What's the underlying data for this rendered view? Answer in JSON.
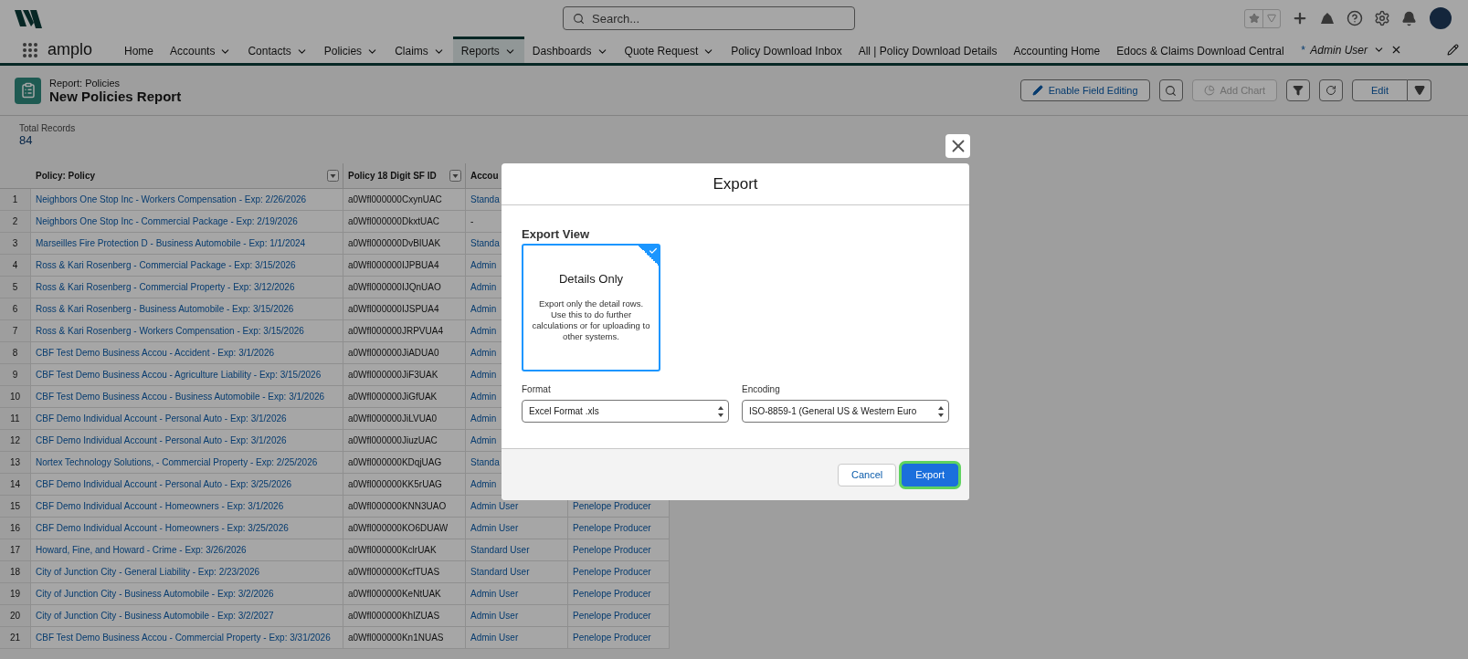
{
  "app": {
    "name": "amplo"
  },
  "search": {
    "placeholder": "Search..."
  },
  "nav": [
    {
      "label": "Home",
      "dropdown": false,
      "selected": false
    },
    {
      "label": "Accounts",
      "dropdown": true,
      "selected": false
    },
    {
      "label": "Contacts",
      "dropdown": true,
      "selected": false
    },
    {
      "label": "Policies",
      "dropdown": true,
      "selected": false
    },
    {
      "label": "Claims",
      "dropdown": true,
      "selected": false
    },
    {
      "label": "Reports",
      "dropdown": true,
      "selected": true
    },
    {
      "label": "Dashboards",
      "dropdown": true,
      "selected": false
    },
    {
      "label": "Quote Request",
      "dropdown": true,
      "selected": false
    },
    {
      "label": "Policy Download Inbox",
      "dropdown": false,
      "selected": false
    },
    {
      "label": "All | Policy Download Details",
      "dropdown": false,
      "selected": false
    },
    {
      "label": "Accounting Home",
      "dropdown": false,
      "selected": false
    },
    {
      "label": "Edocs & Claims Download Central",
      "dropdown": false,
      "selected": false
    }
  ],
  "record_tab": {
    "marker": "*",
    "label": "Admin User"
  },
  "report": {
    "type_label": "Report: Policies",
    "title": "New Policies Report"
  },
  "actions": [
    {
      "label": "Enable Field Editing",
      "disabled": false
    },
    {
      "label": "Add Chart",
      "disabled": true
    },
    {
      "label": "Edit",
      "disabled": false
    }
  ],
  "summary": {
    "label": "Total Records",
    "value": "84"
  },
  "table": {
    "columns": [
      {
        "label": "Policy: Policy",
        "menu": true
      },
      {
        "label": "Policy 18 Digit SF ID",
        "menu": true
      },
      {
        "label": "Accou"
      }
    ],
    "rows": [
      {
        "number": "1",
        "cells": [
          "Neighbors One Stop Inc - Workers Compensation - Exp: 2/26/2026",
          "a0Wfl000000CxynUAC",
          "Standa"
        ]
      },
      {
        "number": "2",
        "cells": [
          "Neighbors One Stop Inc - Commercial Package - Exp: 2/19/2026",
          "a0Wfl000000DkxtUAC",
          "-"
        ]
      },
      {
        "number": "3",
        "cells": [
          "Marseilles Fire Protection D - Business Automobile - Exp: 1/1/2024",
          "a0Wfl000000DvBIUAK",
          "Standa"
        ]
      },
      {
        "number": "4",
        "cells": [
          "Ross & Kari Rosenberg - Commercial Package - Exp: 3/15/2026",
          "a0Wfl000000IJPBUA4",
          "Admin"
        ]
      },
      {
        "number": "5",
        "cells": [
          "Ross & Kari Rosenberg - Commercial Property - Exp: 3/12/2026",
          "a0Wfl000000IJQnUAO",
          "Admin"
        ]
      },
      {
        "number": "6",
        "cells": [
          "Ross & Kari Rosenberg - Business Automobile - Exp: 3/15/2026",
          "a0Wfl000000IJSPUA4",
          "Admin"
        ]
      },
      {
        "number": "7",
        "cells": [
          "Ross & Kari Rosenberg - Workers Compensation - Exp: 3/15/2026",
          "a0Wfl000000JRPVUA4",
          "Admin"
        ]
      },
      {
        "number": "8",
        "cells": [
          "CBF Test Demo Business Accou - Accident - Exp: 3/1/2026",
          "a0Wfl000000JiADUA0",
          "Admin"
        ]
      },
      {
        "number": "9",
        "cells": [
          "CBF Test Demo Business Accou - Agriculture Liability - Exp: 3/15/2026",
          "a0Wfl000000JiF3UAK",
          "Admin"
        ]
      },
      {
        "number": "10",
        "cells": [
          "CBF Test Demo Business Accou - Business Automobile - Exp: 3/1/2026",
          "a0Wfl000000JiGfUAK",
          "Admin"
        ]
      },
      {
        "number": "11",
        "cells": [
          "CBF Demo Individual Account - Personal Auto - Exp: 3/1/2026",
          "a0Wfl000000JiLVUA0",
          "Admin"
        ]
      },
      {
        "number": "12",
        "cells": [
          "CBF Demo Individual Account - Personal Auto - Exp: 3/1/2026",
          "a0Wfl000000JiuzUAC",
          "Admin"
        ]
      },
      {
        "number": "13",
        "cells": [
          "Nortex Technology Solutions, - Commercial Property - Exp: 2/25/2026",
          "a0Wfl000000KDqjUAG",
          "Standa"
        ]
      },
      {
        "number": "14",
        "cells": [
          "CBF Demo Individual Account - Personal Auto - Exp: 3/25/2026",
          "a0Wfl000000KK5rUAG",
          "Admin"
        ]
      },
      {
        "number": "15",
        "cells": [
          "CBF Demo Individual Account - Homeowners - Exp: 3/1/2026",
          "a0Wfl000000KNN3UAO",
          "Admin User",
          "Penelope Producer"
        ]
      },
      {
        "number": "16",
        "cells": [
          "CBF Demo Individual Account - Homeowners - Exp: 3/25/2026",
          "a0Wfl000000KO6DUAW",
          "Admin User",
          "Penelope Producer"
        ]
      },
      {
        "number": "17",
        "cells": [
          "Howard, Fine, and Howard - Crime - Exp: 3/26/2026",
          "a0Wfl000000KclrUAK",
          "Standard User",
          "Penelope Producer"
        ]
      },
      {
        "number": "18",
        "cells": [
          "City of Junction City - General Liability - Exp: 2/23/2026",
          "a0Wfl000000KcfTUAS",
          "Standard User",
          "Penelope Producer"
        ]
      },
      {
        "number": "19",
        "cells": [
          "City of Junction City - Business Automobile - Exp: 3/2/2026",
          "a0Wfl000000KeNtUAK",
          "Admin User",
          "Penelope Producer"
        ]
      },
      {
        "number": "20",
        "cells": [
          "City of Junction City - Business Automobile - Exp: 3/2/2027",
          "a0Wfl000000KhlZUAS",
          "Admin User",
          "Penelope Producer"
        ]
      },
      {
        "number": "21",
        "cells": [
          "CBF Test Demo Business Accou - Commercial Property - Exp: 3/31/2026",
          "a0Wfl000000Kn1NUAS",
          "Admin User",
          "Penelope Producer"
        ]
      }
    ]
  },
  "modal": {
    "title": "Export",
    "section_title": "Export View",
    "options": [
      {
        "title": "Details Only",
        "description": "Export only the detail rows. Use this to do further calculations or for uploading to other systems.",
        "selected": true
      }
    ],
    "fields": [
      {
        "label": "Format",
        "value": "Excel Format .xls"
      },
      {
        "label": "Encoding",
        "value": "ISO-8859-1 (General US & Western Euro"
      }
    ],
    "buttons": [
      {
        "label": "Cancel",
        "kind": "neutral",
        "focused": false
      },
      {
        "label": "Export",
        "kind": "brand",
        "focused": true
      }
    ]
  }
}
